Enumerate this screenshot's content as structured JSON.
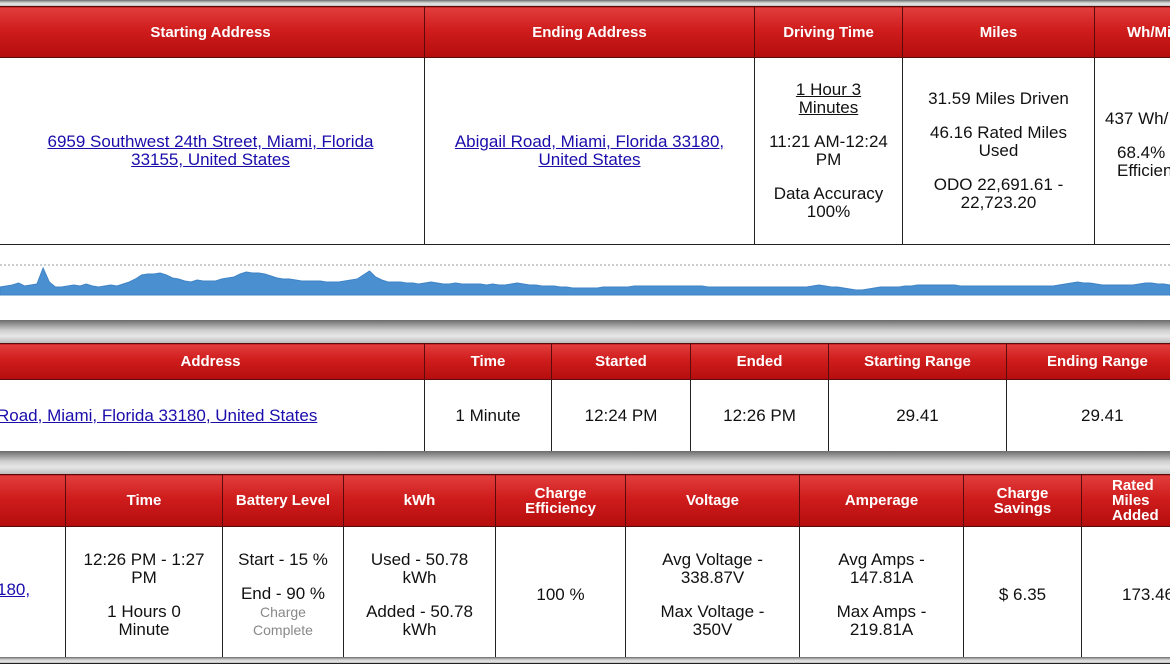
{
  "trip": {
    "headers": [
      "Starting Address",
      "Ending Address",
      "Driving Time",
      "Miles",
      "Wh/Mi"
    ],
    "start_address": "6959 Southwest 24th Street, Miami, Florida 33155, United States",
    "end_address": "Abigail Road, Miami, Florida 33180, United States",
    "driving_duration": "1 Hour 3 Minutes",
    "driving_span": "11:21 AM-12:24 PM",
    "data_accuracy": "Data Accuracy 100%",
    "miles_driven": "31.59 Miles Driven",
    "rated_miles": "46.16 Rated Miles Used",
    "odo": "ODO 22,691.61 - 22,723.20",
    "wh_mi": "437 Wh/",
    "efficiency": "68.4% Efficien"
  },
  "chart_data": {
    "type": "area",
    "title": "",
    "xlabel": "",
    "ylabel": "",
    "grid": false,
    "series": [
      {
        "values": [
          8,
          9,
          10,
          12,
          9,
          10,
          11,
          27,
          13,
          8,
          8,
          9,
          10,
          9,
          11,
          9,
          8,
          9,
          10,
          9,
          11,
          13,
          16,
          20,
          21,
          21,
          22,
          20,
          17,
          16,
          14,
          13,
          15,
          14,
          14,
          14,
          16,
          17,
          18,
          21,
          23,
          22,
          22,
          21,
          19,
          17,
          16,
          16,
          15,
          14,
          14,
          14,
          14,
          13,
          13,
          13,
          14,
          15,
          16,
          20,
          24,
          18,
          15,
          13,
          13,
          13,
          12,
          12,
          11,
          12,
          13,
          12,
          11,
          11,
          12,
          11,
          11,
          11,
          11,
          10,
          11,
          10,
          10,
          11,
          12,
          11,
          10,
          10,
          9,
          9,
          9,
          8,
          8,
          7,
          7,
          7,
          7,
          7,
          8,
          8,
          8,
          8,
          8,
          9,
          9,
          9,
          9,
          9,
          9,
          9,
          9,
          9,
          9,
          9,
          9,
          8,
          8,
          8,
          8,
          8,
          8,
          8,
          8,
          8,
          8,
          8,
          8,
          8,
          8,
          8,
          8,
          8,
          9,
          10,
          9,
          8,
          8,
          7,
          6,
          5,
          5,
          6,
          7,
          8,
          8,
          8,
          8,
          9,
          9,
          10,
          10,
          10,
          10,
          10,
          10,
          10,
          9,
          9,
          9,
          9,
          9,
          9,
          9,
          9,
          9,
          9,
          9,
          9,
          9,
          9,
          9,
          9,
          10,
          11,
          12,
          13,
          12,
          12,
          11,
          10,
          10,
          10,
          10,
          10,
          10,
          11,
          12,
          12,
          11,
          11,
          10
        ]
      }
    ]
  },
  "charging": {
    "headers": [
      "Address",
      "Time",
      "Started",
      "Ended",
      "Starting Range",
      "Ending Range"
    ],
    "address": "Road, Miami, Florida 33180, United States",
    "time": "1 Minute",
    "started": "12:24 PM",
    "ended": "12:26 PM",
    "starting_range": "29.41",
    "ending_range": "29.41"
  },
  "session": {
    "headers": [
      "",
      "Time",
      "Battery Level",
      "kWh",
      "Charge Efficiency",
      "Voltage",
      "Amperage",
      "Charge Savings",
      "Rated Miles Added"
    ],
    "address_fragment": "180,",
    "time_span": "12:26 PM - 1:27 PM",
    "duration": "1 Hours 0 Minute",
    "battery_start": "Start - 15 %",
    "battery_end": "End - 90 %",
    "charge_status": "Charge Complete",
    "kwh_used": "Used - 50.78 kWh",
    "kwh_added": "Added - 50.78 kWh",
    "charge_efficiency": "100 %",
    "avg_voltage": "Avg Voltage - 338.87V",
    "max_voltage": "Max Voltage - 350V",
    "avg_amps": "Avg Amps - 147.81A",
    "max_amps": "Max Amps - 219.81A",
    "savings": "$ 6.35",
    "rated_miles_added": "173.46"
  },
  "colors": {
    "header_red": "#cf1c1c",
    "chart_fill": "#4a90d0",
    "link": "#1a0dab"
  }
}
